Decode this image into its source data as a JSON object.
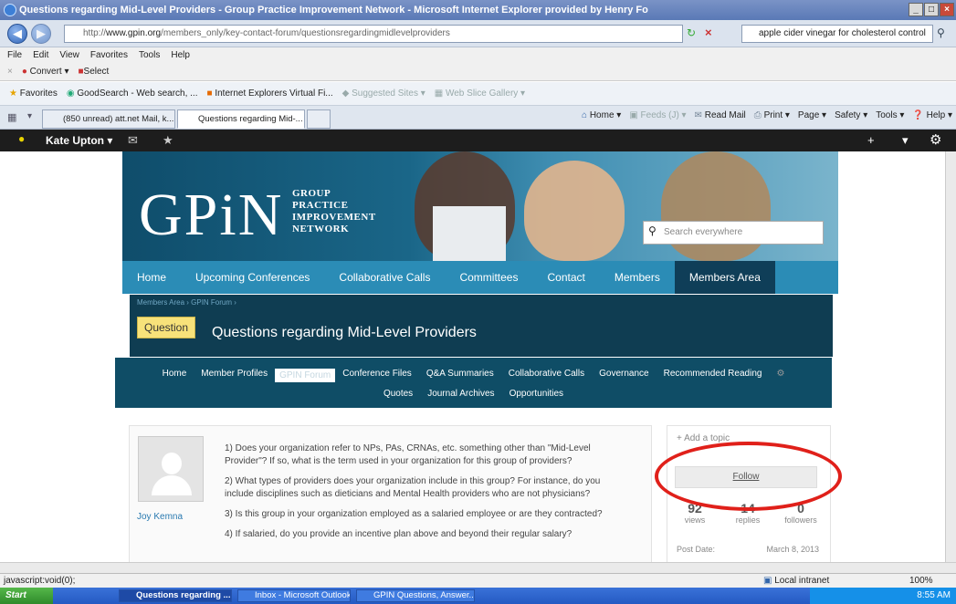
{
  "window": {
    "title": "Questions regarding Mid-Level Providers - Group Practice Improvement Network - Microsoft Internet Explorer provided by Henry Fo",
    "buttons": [
      "_",
      "□",
      "×"
    ]
  },
  "address": {
    "url_prefix": "http://",
    "url_host": "www.gpin.org",
    "url_path": "/members_only/key-contact-forum/questionsregardingmidlevelproviders",
    "search_value": "apple cider vinegar for cholesterol control"
  },
  "menu": [
    "File",
    "Edit",
    "View",
    "Favorites",
    "Tools",
    "Help"
  ],
  "command": {
    "convert": "Convert",
    "select": "Select"
  },
  "favorites": {
    "label": "Favorites",
    "items": [
      "GoodSearch - Web search, ...",
      "Internet Explorers Virtual Fi...",
      "Suggested Sites ▾",
      "Web Slice Gallery ▾"
    ]
  },
  "tabs": [
    {
      "label": "(850 unread) att.net Mail, k..."
    },
    {
      "label": "Questions regarding Mid-... ×"
    }
  ],
  "ie_tools": {
    "home": "Home ▾",
    "feeds": "Feeds (J) ▾",
    "read_mail": "Read Mail",
    "print": "Print ▾",
    "page": "Page ▾",
    "safety": "Safety ▾",
    "tools": "Tools ▾",
    "help": "Help ▾"
  },
  "adminbar": {
    "user": "Kate Upton ▾"
  },
  "site": {
    "logo": "GPiN",
    "logo_lines": [
      "GROUP",
      "PRACTICE",
      "IMPROVEMENT",
      "NETWORK"
    ],
    "search_placeholder": "Search everywhere",
    "nav": [
      "Home",
      "Upcoming Conferences",
      "Collaborative Calls",
      "Committees",
      "Contact",
      "Members",
      "Members Area"
    ]
  },
  "question": {
    "breadcrumb": "Members Area › GPIN Forum ›",
    "badge": "Question",
    "title": "Questions regarding Mid-Level Providers"
  },
  "subnav": {
    "row1": [
      "Home",
      "Member Profiles",
      "GPIN Forum",
      "Conference Files",
      "Q&A Summaries",
      "Collaborative Calls",
      "Governance",
      "Recommended Reading"
    ],
    "row2": [
      "Quotes",
      "Journal Archives",
      "Opportunities"
    ]
  },
  "post": {
    "author": "Joy Kemna",
    "paragraphs": [
      "1)    Does your organization refer to NPs, PAs, CRNAs, etc. something other than \"Mid-Level Provider\"?  If so, what is the term used in your organization for this group of providers?",
      "2)    What types of providers does your organization include in this group?  For instance, do you include disciplines such as dieticians and Mental Health providers who are not physicians?",
      "3)    Is this group in your organization employed as a salaried employee or are they contracted?",
      "4)    If salaried, do you provide an incentive plan above and beyond their regular salary?"
    ]
  },
  "sidebar": {
    "add_topic": "+  Add a topic",
    "follow": "Follow",
    "stats": [
      {
        "n": "92",
        "label": "views"
      },
      {
        "n": "14",
        "label": "replies"
      },
      {
        "n": "0",
        "label": "followers"
      }
    ],
    "post_date_label": "Post Date:",
    "post_date": "March 8, 2013"
  },
  "status": {
    "left": "javascript:void(0);",
    "zone": "Local intranet",
    "zoom": "100%"
  },
  "taskbar": {
    "start": "Start",
    "items": [
      "Questions regarding ...",
      "Inbox - Microsoft Outlook",
      "GPIN Questions, Answer..."
    ],
    "time": "8:55 AM"
  }
}
